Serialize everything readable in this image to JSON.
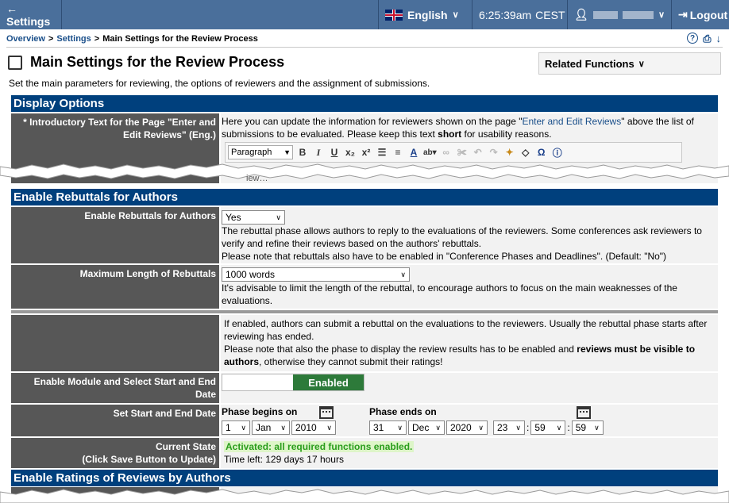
{
  "topbar": {
    "back_label": "← Settings",
    "language": "English",
    "time": "6:25:39am",
    "timezone": "CEST",
    "logout": "Logout"
  },
  "breadcrumb": {
    "items": [
      "Overview",
      "Settings",
      "Main Settings for the Review Process"
    ],
    "separator": ">"
  },
  "page": {
    "title": "Main Settings for the Review Process",
    "related_functions": "Related Functions",
    "description": "Set the main parameters for reviewing, the options of reviewers and the assignment of submissions."
  },
  "display_options": {
    "header": "Display Options",
    "intro_label": "* Introductory Text for the Page \"Enter and Edit Reviews\" (Eng.)",
    "intro_text_1": "Here you can update the information for reviewers shown on the page \"",
    "intro_link": "Enter and Edit Reviews",
    "intro_text_2": "\" above the list of submissions to be evaluated. Please keep this text ",
    "intro_bold": "short",
    "intro_text_3": " for usability reasons.",
    "format_select": "Paragraph",
    "cut_text": "iew…"
  },
  "rebuttals": {
    "header": "Enable Rebuttals for Authors",
    "enable_label": "Enable Rebuttals for Authors",
    "enable_value": "Yes",
    "enable_help": "The rebuttal phase allows authors to reply to the evaluations of the reviewers. Some conferences ask reviewers to verify and refine their reviews based on the authors' rebuttals.",
    "enable_note": "Please note that rebuttals also have to be enabled in \"Conference Phases and Deadlines\". (Default: \"No\")",
    "maxlen_label": "Maximum Length of Rebuttals",
    "maxlen_value": "1000 words",
    "maxlen_help": "It's advisable to limit the length of the rebuttal, to encourage authors to focus on the main weaknesses of the evaluations."
  },
  "module": {
    "info_1": "If enabled, authors can submit a rebuttal on the evaluations to the reviewers. Usually the rebuttal phase starts after reviewing has ended.",
    "info_2a": "Please note that also the phase to display the review results has to be enabled and ",
    "info_2b": "reviews must be visible to authors",
    "info_2c": ", otherwise they cannot submit their ratings!",
    "enable_label": "Enable Module and Select Start and End Date",
    "toggle_state": "Enabled",
    "dates_label": "Set Start and End Date",
    "begins_label": "Phase begins on",
    "ends_label": "Phase ends on",
    "begin_day": "1",
    "begin_month": "Jan",
    "begin_year": "2010",
    "end_day": "31",
    "end_month": "Dec",
    "end_year": "2020",
    "end_hour": "23",
    "end_minute": "59",
    "end_second": "59",
    "time_sep": ":",
    "state_label_1": "Current State",
    "state_label_2": "(Click Save Button to Update)",
    "state_active": "Activated: all required functions enabled.",
    "time_left": "Time left: 129 days 17 hours"
  },
  "ratings": {
    "header": "Enable Ratings of Reviews by Authors"
  }
}
